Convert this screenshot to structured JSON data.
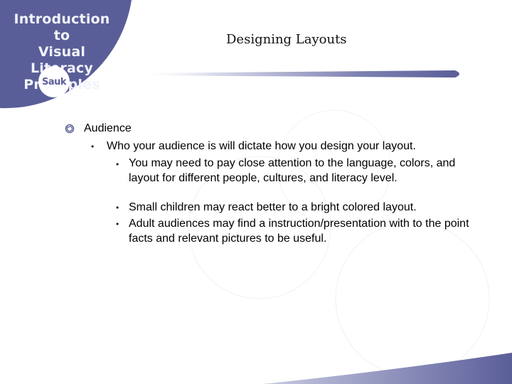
{
  "header": {
    "corner_title": "Introduction to\nVisual Literacy\nPrinciples",
    "logo_text": "Sauk",
    "slide_title": "Designing  Layouts"
  },
  "content": {
    "heading": "Audience",
    "sub_point": "Who your audience is will dictate how you design your layout.",
    "details": [
      "You may need to pay close attention to the language, colors, and layout for different people, cultures, and literacy level.",
      "Small children may react better to a bright colored layout.",
      "Adult audiences may find a instruction/presentation with to the point facts and relevant pictures to be useful."
    ]
  },
  "colors": {
    "brand": "#5a5e98",
    "accent_light": "#c9cbe3"
  }
}
